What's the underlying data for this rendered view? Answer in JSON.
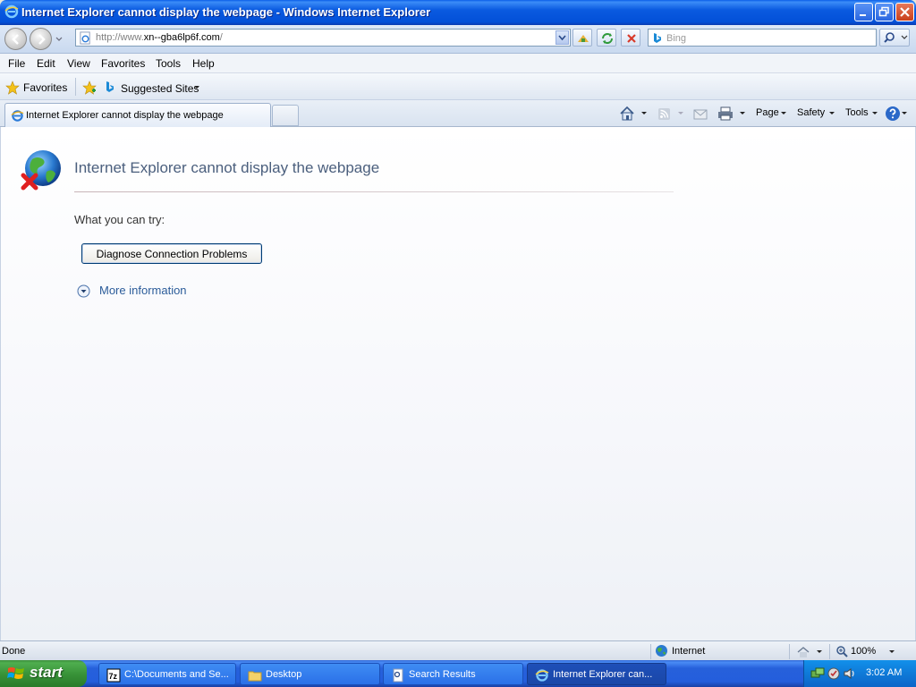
{
  "window": {
    "title": "Internet Explorer cannot display the webpage - Windows Internet Explorer"
  },
  "address": {
    "url_prefix": "http://www.",
    "url_host": "xn--gba6lp6f.com",
    "url_suffix": "/"
  },
  "search": {
    "placeholder": "Bing"
  },
  "menu": [
    "File",
    "Edit",
    "View",
    "Favorites",
    "Tools",
    "Help"
  ],
  "favorites_bar": {
    "favorites_label": "Favorites",
    "suggested_sites_label": "Suggested Sites"
  },
  "tab": {
    "label": "Internet Explorer cannot display the webpage"
  },
  "command_bar": {
    "page": "Page",
    "safety": "Safety",
    "tools": "Tools"
  },
  "error_page": {
    "title": "Internet Explorer cannot display the webpage",
    "what_you_can_try": "What you can try:",
    "diagnose_button": "Diagnose Connection Problems",
    "more_info": "More information"
  },
  "status": {
    "text": "Done",
    "zone": "Internet",
    "zoom": "100%"
  },
  "taskbar": {
    "start": "start",
    "tasks": [
      {
        "label": "C:\\Documents and Se..."
      },
      {
        "label": "Desktop"
      },
      {
        "label": "Search Results"
      },
      {
        "label": "Internet Explorer can..."
      }
    ],
    "clock": "3:02 AM"
  },
  "colors": {
    "title_bar": "#0a5ae0",
    "error_title": "#4b5f7d",
    "link": "#2b5c9a",
    "taskbar": "#245edc",
    "start_button": "#379137"
  }
}
